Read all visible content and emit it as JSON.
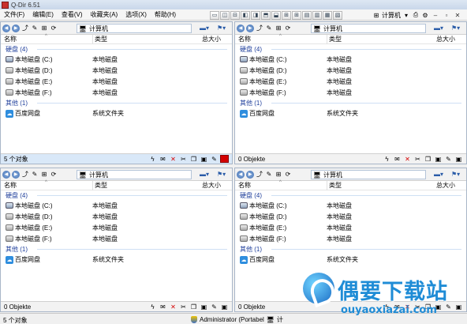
{
  "window": {
    "title": "Q-Dir 6.51"
  },
  "menu": [
    "文件(F)",
    "编辑(E)",
    "查看(V)",
    "收藏夹(A)",
    "选项(X)",
    "帮助(H)"
  ],
  "toolbar": {
    "location_label": "计算机"
  },
  "columns": {
    "name": "名称",
    "type": "类型",
    "size": "总大小"
  },
  "groups": {
    "drives": {
      "label": "硬盘 (4)"
    },
    "other": {
      "label": "其他 (1)"
    }
  },
  "drives": [
    {
      "name": "本地磁盘 (C:)",
      "type": "本地磁盘",
      "icon": "system-drive-icon"
    },
    {
      "name": "本地磁盘 (D:)",
      "type": "本地磁盘",
      "icon": "drive-icon"
    },
    {
      "name": "本地磁盘 (E:)",
      "type": "本地磁盘",
      "icon": "drive-icon"
    },
    {
      "name": "本地磁盘 (F:)",
      "type": "本地磁盘",
      "icon": "drive-icon"
    }
  ],
  "other_items": [
    {
      "name": "百度网盘",
      "type": "系统文件夹",
      "icon": "cloud-drive-icon"
    }
  ],
  "panes": [
    {
      "id": "top-left",
      "path": "计算机",
      "status": "5 个对象",
      "active": true
    },
    {
      "id": "top-right",
      "path": "计算机",
      "status": "0 Objekte",
      "active": false
    },
    {
      "id": "bottom-left",
      "path": "计算机",
      "status": "0 Objekte",
      "active": false
    },
    {
      "id": "bottom-right",
      "path": "计算机",
      "status": "0 Objekte",
      "active": false
    }
  ],
  "statusbar": {
    "count": "5 个对象",
    "user": "Administrator (Portabel",
    "location": "计"
  },
  "watermark": {
    "title": "偶要下载站",
    "url": "ouyaoxiazai.com"
  },
  "colors": {
    "group_header": "#1e3e9b",
    "active_status": "#d9e8f8",
    "accent_red": "#d40000",
    "watermark": "#1f8cd6"
  }
}
